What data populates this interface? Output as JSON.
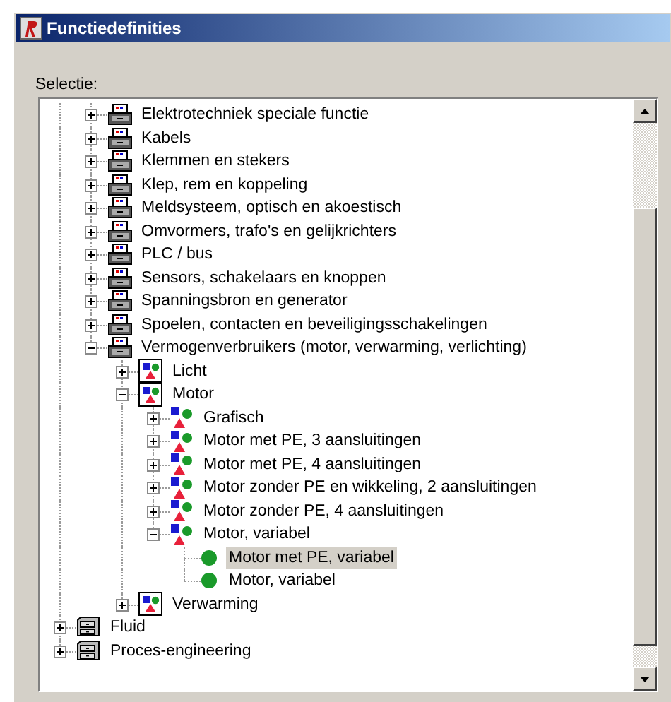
{
  "window": {
    "title": "Functiedefinities"
  },
  "selection_label": "Selectie:",
  "tree": {
    "branch_items": [
      {
        "label": "Elektrotechniek speciale functie",
        "kind": "cabinet",
        "expanded": false,
        "selected": false
      },
      {
        "label": "Kabels",
        "kind": "cabinet",
        "expanded": false,
        "selected": false
      },
      {
        "label": "Klemmen en stekers",
        "kind": "cabinet",
        "expanded": false,
        "selected": false
      },
      {
        "label": "Klep, rem en koppeling",
        "kind": "cabinet",
        "expanded": false,
        "selected": false
      },
      {
        "label": "Meldsysteem, optisch en akoestisch",
        "kind": "cabinet",
        "expanded": false,
        "selected": false
      },
      {
        "label": "Omvormers, trafo's en gelijkrichters",
        "kind": "cabinet",
        "expanded": false,
        "selected": false
      },
      {
        "label": "PLC / bus",
        "kind": "cabinet",
        "expanded": false,
        "selected": false
      },
      {
        "label": "Sensors, schakelaars en knoppen",
        "kind": "cabinet",
        "expanded": false,
        "selected": false
      },
      {
        "label": "Spanningsbron en generator",
        "kind": "cabinet",
        "expanded": false,
        "selected": false
      },
      {
        "label": "Spoelen, contacten en beveiligingsschakelingen",
        "kind": "cabinet",
        "expanded": false,
        "selected": false
      },
      {
        "label": "Vermogenverbruikers (motor, verwarming, verlichting)",
        "kind": "cabinet",
        "expanded": true,
        "selected": false,
        "children": [
          {
            "label": "Licht",
            "kind": "framed-symbol",
            "expanded": false,
            "selected": false
          },
          {
            "label": "Motor",
            "kind": "framed-symbol",
            "expanded": true,
            "selected": false,
            "children": [
              {
                "label": "Grafisch",
                "kind": "symbol",
                "expanded": false,
                "selected": false
              },
              {
                "label": "Motor met PE, 3 aansluitingen",
                "kind": "symbol",
                "expanded": false,
                "selected": false
              },
              {
                "label": "Motor met PE, 4 aansluitingen",
                "kind": "symbol",
                "expanded": false,
                "selected": false
              },
              {
                "label": "Motor zonder PE en wikkeling, 2 aansluitingen",
                "kind": "symbol",
                "expanded": false,
                "selected": false
              },
              {
                "label": "Motor zonder PE, 4 aansluitingen",
                "kind": "symbol",
                "expanded": false,
                "selected": false
              },
              {
                "label": "Motor, variabel",
                "kind": "symbol",
                "expanded": true,
                "selected": false,
                "children": [
                  {
                    "label": "Motor met PE, variabel",
                    "kind": "dot",
                    "selected": true
                  },
                  {
                    "label": "Motor, variabel",
                    "kind": "dot",
                    "selected": false
                  }
                ]
              }
            ]
          },
          {
            "label": "Verwarming",
            "kind": "framed-symbol",
            "expanded": false,
            "selected": false
          }
        ]
      }
    ],
    "items": [
      {
        "label": "Fluid",
        "kind": "drawer",
        "expanded": false,
        "selected": false
      },
      {
        "label": "Proces-engineering",
        "kind": "drawer",
        "expanded": false,
        "selected": false
      }
    ]
  }
}
